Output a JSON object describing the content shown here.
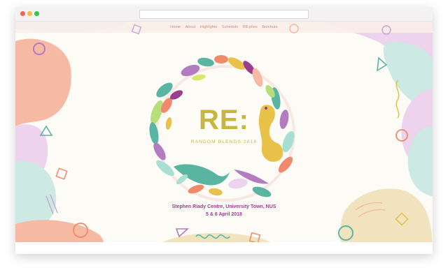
{
  "nav": {
    "items": [
      "Home",
      "About",
      "Highlights",
      "Schedule",
      "RE:plies",
      "Brochure"
    ]
  },
  "hero": {
    "logo_text": "RE:",
    "subtitle": "RANDOM BLENDS 2018",
    "venue": "Stephen Riady Centre, University Town, NUS",
    "dates": "5 & 6 April 2018"
  },
  "colors": {
    "background": "#fdfbf6",
    "nav_text": "#c9907b",
    "logo": "#c6b642",
    "venue_text": "#9a3d8e",
    "peach": "#f5b9a4",
    "mint": "#cde9e3",
    "lavender": "#edd3ee",
    "butter": "#f1e3bd",
    "teal": "#59b5a1"
  }
}
